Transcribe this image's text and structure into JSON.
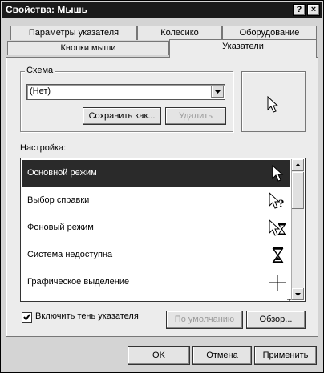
{
  "window": {
    "title": "Свойства: Мышь",
    "help_button": "?",
    "close_button": "×"
  },
  "tabs": {
    "back_row": [
      "Параметры указателя",
      "Колесико",
      "Оборудование"
    ],
    "front_row": [
      "Кнопки мыши",
      "Указатели"
    ],
    "active": "Указатели"
  },
  "scheme": {
    "group_label": "Схема",
    "selected": "(Нет)",
    "save_button": "Сохранить как...",
    "delete_button": "Удалить"
  },
  "customize": {
    "label": "Настройка:",
    "items": [
      {
        "label": "Основной режим",
        "icon": "arrow-cursor-icon",
        "selected": true
      },
      {
        "label": "Выбор справки",
        "icon": "help-cursor-icon",
        "selected": false
      },
      {
        "label": "Фоновый режим",
        "icon": "busy-background-cursor-icon",
        "selected": false
      },
      {
        "label": "Система недоступна",
        "icon": "hourglass-icon",
        "selected": false
      },
      {
        "label": "Графическое выделение",
        "icon": "crosshair-icon",
        "selected": false
      }
    ]
  },
  "shadow_checkbox": {
    "label": "Включить тень указателя",
    "checked": true
  },
  "default_button": "По умолчанию",
  "browse_button": "Обзор...",
  "footer": {
    "ok": "OK",
    "cancel": "Отмена",
    "apply": "Применить"
  }
}
